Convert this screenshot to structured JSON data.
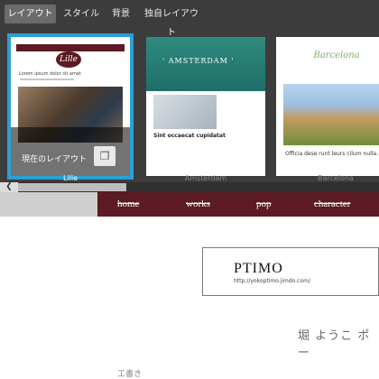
{
  "tabs": [
    {
      "label": "レイアウト",
      "active": true
    },
    {
      "label": "スタイル",
      "active": false
    },
    {
      "label": "背景",
      "active": false
    },
    {
      "label": "独自レイアウト",
      "active": false
    }
  ],
  "layouts": [
    {
      "name": "Lille",
      "logo_text": "Lille",
      "title_text": "Lorem ipsum dolor sit amet",
      "selected": true
    },
    {
      "name": "Amsterdam",
      "hero_text": "' AMSTERDAM '",
      "heading_text": "Sint occaecat cupidatat",
      "selected": false
    },
    {
      "name": "Barcelona",
      "logo_text": "Barcelona",
      "caption_text": "Officia dese runt leurs cilum nulla.",
      "selected": false
    }
  ],
  "current_layout_label": "現在のレイアウト",
  "icons": {
    "copy": "copy-icon",
    "scroll_left": "chevron-left-icon"
  },
  "site": {
    "nav": [
      "home",
      "works",
      "pop",
      "character"
    ],
    "logo": "PTIMO",
    "url": "http://yokoptimo.jimdo.com/",
    "name_partial": "堀 ようこ ポー",
    "bottom_partial": "工書き"
  },
  "colors": {
    "accent": "#2a9fd8",
    "nav_bg": "#5c1a24",
    "panel_bg": "#3c3c3c"
  }
}
